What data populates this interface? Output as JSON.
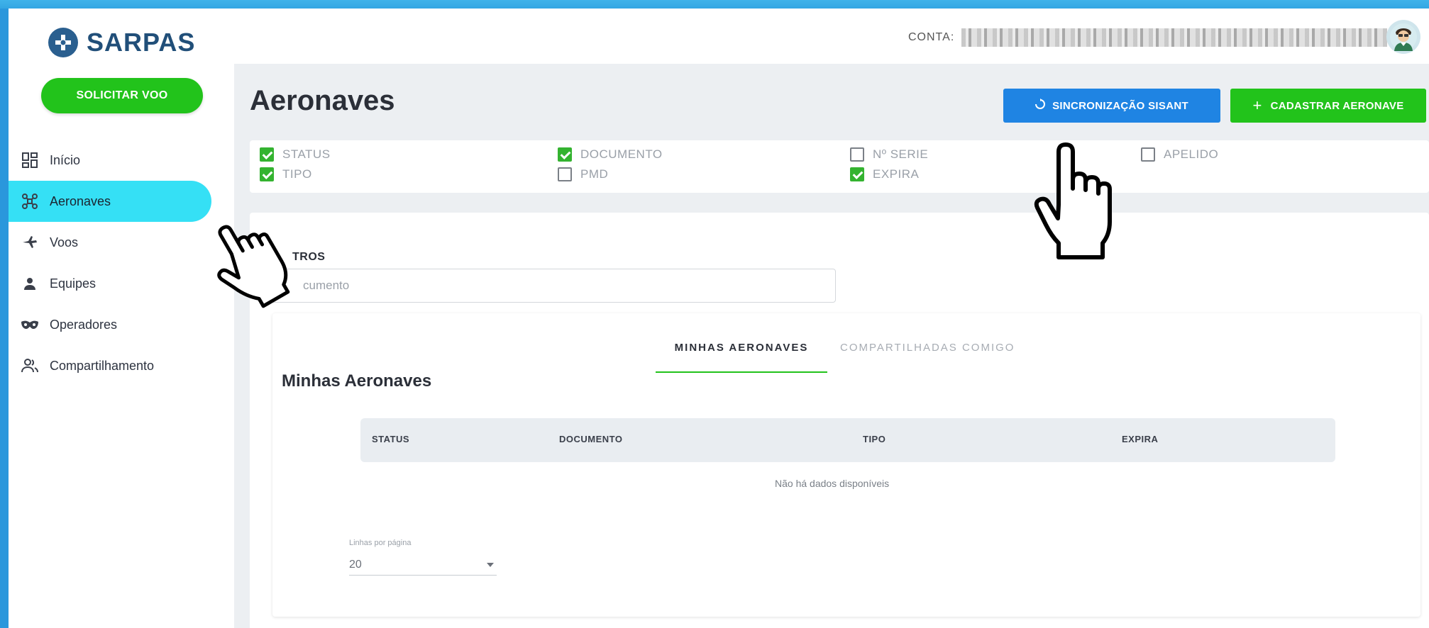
{
  "brand": {
    "name": "SARPAS"
  },
  "sidebar": {
    "cta_label": "SOLICITAR VOO",
    "items": [
      {
        "label": "Início",
        "icon": "dashboard-icon",
        "active": false
      },
      {
        "label": "Aeronaves",
        "icon": "drone-icon",
        "active": true
      },
      {
        "label": "Voos",
        "icon": "plane-icon",
        "active": false
      },
      {
        "label": "Equipes",
        "icon": "person-icon",
        "active": false
      },
      {
        "label": "Operadores",
        "icon": "mask-icon",
        "active": false
      },
      {
        "label": "Compartilhamento",
        "icon": "group-icon",
        "active": false
      }
    ]
  },
  "header": {
    "account_label": "CONTA:"
  },
  "page": {
    "title": "Aeronaves",
    "sync_button": "SINCRONIZAÇÃO SISANT",
    "add_button": "CADASTRAR AERONAVE"
  },
  "columns": [
    {
      "label": "STATUS",
      "checked": true
    },
    {
      "label": "TIPO",
      "checked": true
    },
    {
      "label": "DOCUMENTO",
      "checked": true
    },
    {
      "label": "PMD",
      "checked": false
    },
    {
      "label": "Nº SERIE",
      "checked": false
    },
    {
      "label": "EXPIRA",
      "checked": true
    },
    {
      "label": "APELIDO",
      "checked": false
    }
  ],
  "filters": {
    "label": "TROS",
    "document_placeholder": "cumento"
  },
  "tabs": [
    {
      "label": "MINHAS AERONAVES",
      "active": true
    },
    {
      "label": "COMPARTILHADAS COMIGO",
      "active": false
    }
  ],
  "table": {
    "title": "Minhas Aeronaves",
    "headers": [
      "STATUS",
      "DOCUMENTO",
      "TIPO",
      "EXPIRA"
    ],
    "empty_text": "Não há dados disponíveis",
    "rows_per_page_label": "Linhas por página",
    "rows_per_page_value": "20"
  },
  "colors": {
    "primary_green": "#22c31b",
    "sync_blue": "#1f84e3",
    "active_nav": "#35e0f5",
    "brand_blue": "#214f79"
  }
}
